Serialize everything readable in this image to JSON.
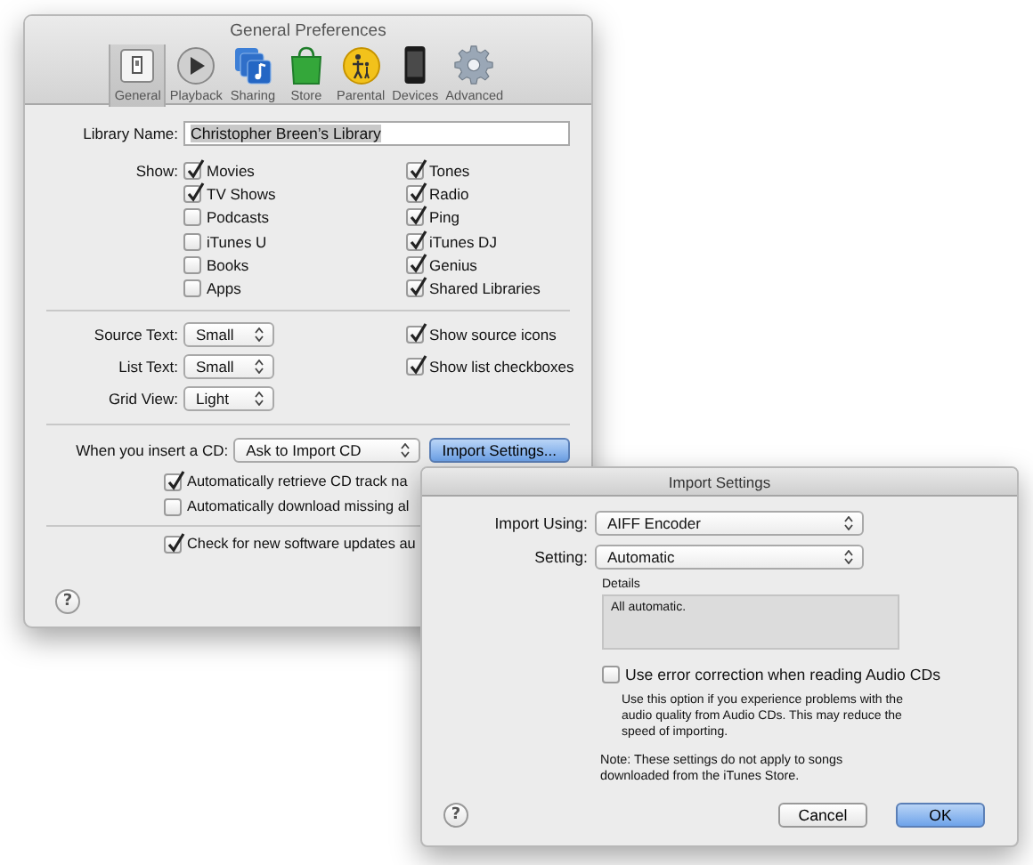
{
  "main_window": {
    "title": "General Preferences",
    "toolbar": [
      {
        "label": "General",
        "selected": true
      },
      {
        "label": "Playback",
        "selected": false
      },
      {
        "label": "Sharing",
        "selected": false
      },
      {
        "label": "Store",
        "selected": false
      },
      {
        "label": "Parental",
        "selected": false
      },
      {
        "label": "Devices",
        "selected": false
      },
      {
        "label": "Advanced",
        "selected": false
      }
    ],
    "library_name": {
      "label": "Library Name:",
      "value": "Christopher Breen’s Library",
      "text_selected": true
    },
    "show": {
      "label": "Show:",
      "left": [
        {
          "label": "Movies",
          "checked": true
        },
        {
          "label": "TV Shows",
          "checked": true
        },
        {
          "label": "Podcasts",
          "checked": false
        },
        {
          "label": "iTunes U",
          "checked": false
        },
        {
          "label": "Books",
          "checked": false
        },
        {
          "label": "Apps",
          "checked": false
        }
      ],
      "right": [
        {
          "label": "Tones",
          "checked": true
        },
        {
          "label": "Radio",
          "checked": true
        },
        {
          "label": "Ping",
          "checked": true
        },
        {
          "label": "iTunes DJ",
          "checked": true
        },
        {
          "label": "Genius",
          "checked": true
        },
        {
          "label": "Shared Libraries",
          "checked": true
        }
      ]
    },
    "display_menus": [
      {
        "label": "Source Text:",
        "value": "Small"
      },
      {
        "label": "List Text:",
        "value": "Small"
      },
      {
        "label": "Grid View:",
        "value": "Light"
      }
    ],
    "display_checks": [
      {
        "label": "Show source icons",
        "checked": true
      },
      {
        "label": "Show list checkboxes",
        "checked": true
      }
    ],
    "cd": {
      "label": "When you insert a CD:",
      "value": "Ask to Import CD",
      "button": "Import Settings...",
      "checks": [
        {
          "label": "Automatically retrieve CD track na",
          "checked": true
        },
        {
          "label": "Automatically download missing al",
          "checked": false
        }
      ]
    },
    "updates": {
      "label": "Check for new software updates au",
      "checked": true
    },
    "help_button": "?"
  },
  "import_dialog": {
    "title": "Import Settings",
    "menus": [
      {
        "label": "Import Using:",
        "value": "AIFF Encoder"
      },
      {
        "label": "Setting:",
        "value": "Automatic"
      }
    ],
    "details": {
      "label": "Details",
      "text": "All automatic."
    },
    "error_correction": {
      "label": "Use error correction when reading Audio CDs",
      "checked": false,
      "description": "Use this option if you experience problems with the audio quality from Audio CDs.  This may reduce the speed of importing."
    },
    "note": "Note: These settings do not apply to songs downloaded from the iTunes Store.",
    "help_button": "?",
    "buttons": [
      {
        "label": "Cancel",
        "default": false
      },
      {
        "label": "OK",
        "default": true
      }
    ]
  }
}
